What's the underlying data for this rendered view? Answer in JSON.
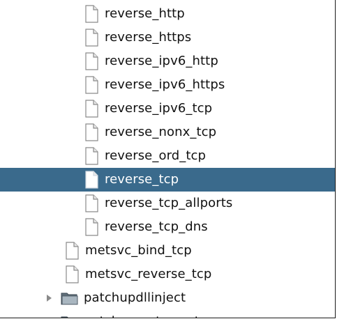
{
  "tree": {
    "items": [
      {
        "label": "reverse_http",
        "type": "file",
        "level": 3,
        "selected": false
      },
      {
        "label": "reverse_https",
        "type": "file",
        "level": 3,
        "selected": false
      },
      {
        "label": "reverse_ipv6_http",
        "type": "file",
        "level": 3,
        "selected": false
      },
      {
        "label": "reverse_ipv6_https",
        "type": "file",
        "level": 3,
        "selected": false
      },
      {
        "label": "reverse_ipv6_tcp",
        "type": "file",
        "level": 3,
        "selected": false
      },
      {
        "label": "reverse_nonx_tcp",
        "type": "file",
        "level": 3,
        "selected": false
      },
      {
        "label": "reverse_ord_tcp",
        "type": "file",
        "level": 3,
        "selected": false
      },
      {
        "label": "reverse_tcp",
        "type": "file",
        "level": 3,
        "selected": true
      },
      {
        "label": "reverse_tcp_allports",
        "type": "file",
        "level": 3,
        "selected": false
      },
      {
        "label": "reverse_tcp_dns",
        "type": "file",
        "level": 3,
        "selected": false
      },
      {
        "label": "metsvc_bind_tcp",
        "type": "file",
        "level": 2,
        "selected": false
      },
      {
        "label": "metsvc_reverse_tcp",
        "type": "file",
        "level": 2,
        "selected": false
      },
      {
        "label": "patchupdllinject",
        "type": "folder",
        "level": 1,
        "selected": false
      },
      {
        "label": "patchupmeterpreter",
        "type": "folder",
        "level": 1,
        "selected": false
      }
    ]
  },
  "colors": {
    "selection": "#3a6a8c",
    "text": "#111111",
    "selected_text": "#ffffff"
  }
}
